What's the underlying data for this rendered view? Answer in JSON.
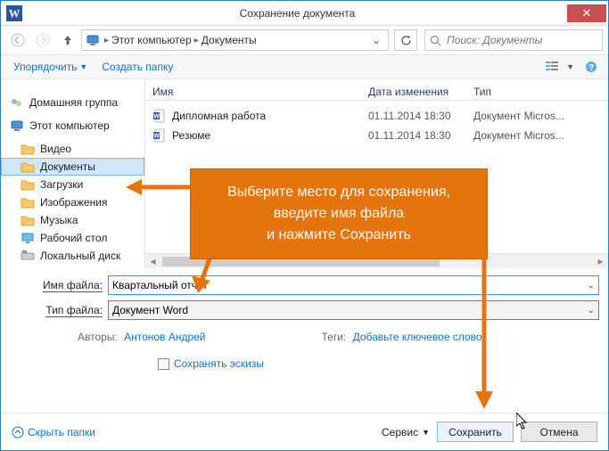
{
  "title": "Сохранение документа",
  "breadcrumb": {
    "root": "Этот компьютер",
    "folder": "Документы"
  },
  "search": {
    "placeholder": "Поиск: Документы"
  },
  "toolbar": {
    "organize": "Упорядочить",
    "newfolder": "Создать папку"
  },
  "headers": {
    "name": "Имя",
    "date": "Дата изменения",
    "type": "Тип"
  },
  "sidebar": {
    "homegroup": "Домашняя группа",
    "thispc": "Этот компьютер",
    "items": [
      "Видео",
      "Документы",
      "Загрузки",
      "Изображения",
      "Музыка",
      "Рабочий стол",
      "Локальный диск"
    ]
  },
  "files": [
    {
      "name": "Дипломная работа",
      "date": "01.11.2014 18:30",
      "type": "Документ Micros..."
    },
    {
      "name": "Резюме",
      "date": "01.11.2014 18:30",
      "type": "Документ Micros..."
    }
  ],
  "form": {
    "filename_label": "Имя файла:",
    "filename_value": "Квартальный отчет",
    "filetype_label": "Тип файла:",
    "filetype_value": "Документ Word",
    "authors_k": "Авторы:",
    "authors_v": "Антонов Андрей",
    "tags_k": "Теги:",
    "tags_v": "Добавьте ключевое слово",
    "thumbs": "Сохранять эскизы"
  },
  "footer": {
    "hide": "Скрыть папки",
    "tools": "Сервис",
    "save": "Сохранить",
    "cancel": "Отмена"
  },
  "callout": {
    "l1": "Выберите место для сохранения,",
    "l2": "введите имя файла",
    "l3": "и нажмите Сохранить"
  }
}
